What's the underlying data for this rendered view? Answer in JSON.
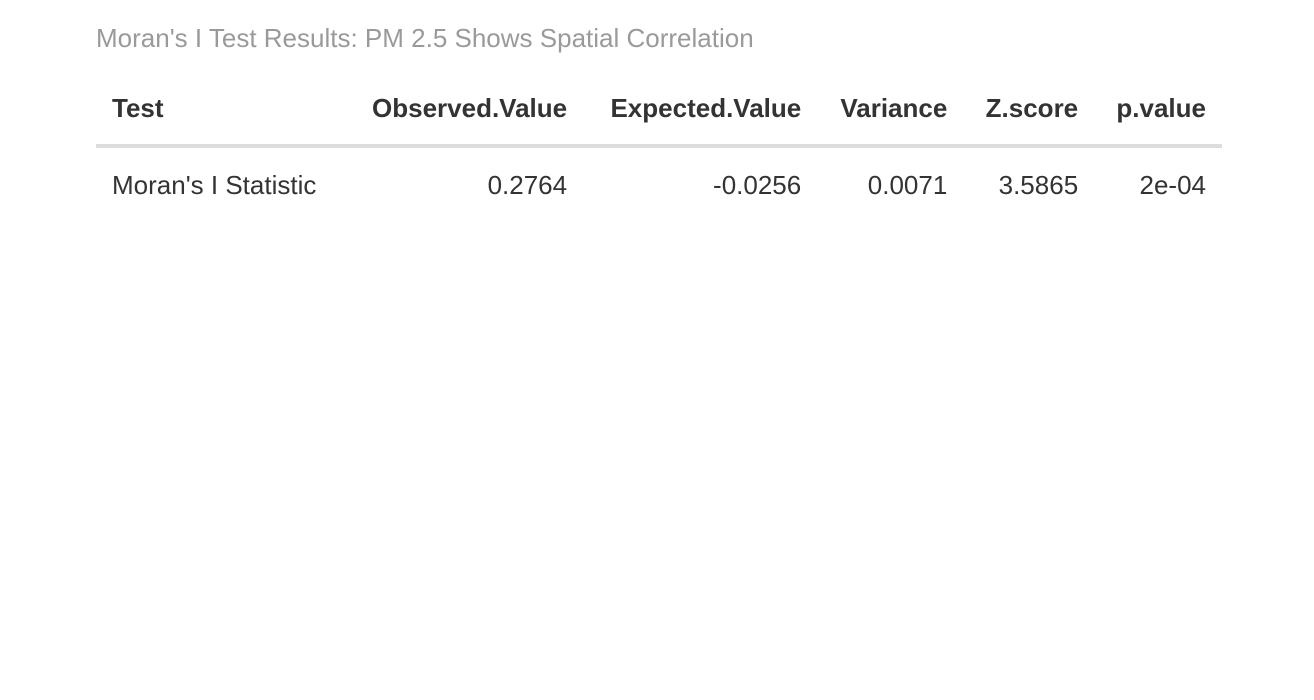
{
  "caption": "Moran's I Test Results: PM 2.5 Shows Spatial Correlation",
  "table": {
    "headers": [
      "Test",
      "Observed.Value",
      "Expected.Value",
      "Variance",
      "Z.score",
      "p.value"
    ],
    "rows": [
      [
        "Moran's I Statistic",
        "0.2764",
        "-0.0256",
        "0.0071",
        "3.5865",
        "2e-04"
      ]
    ]
  }
}
